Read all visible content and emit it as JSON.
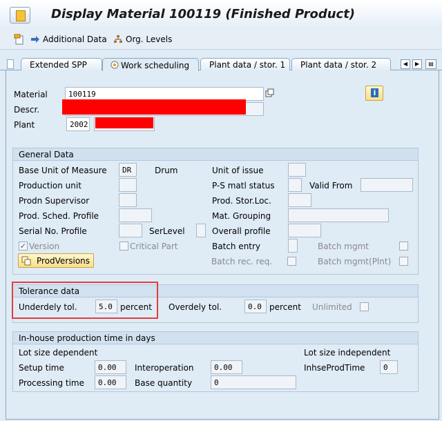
{
  "window": {
    "title": "Display Material 100119 (Finished Product)"
  },
  "toolbar": {
    "additional_data": "Additional Data",
    "org_levels": "Org. Levels"
  },
  "tabs": [
    {
      "label": "Extended SPP"
    },
    {
      "label": "Work scheduling"
    },
    {
      "label": "Plant data / stor. 1"
    },
    {
      "label": "Plant data / stor. 2"
    }
  ],
  "header": {
    "material_label": "Material",
    "material_value": "100119",
    "descr_label": "Descr.",
    "plant_label": "Plant",
    "plant_value": "2002"
  },
  "general": {
    "title": "General Data",
    "base_uom_label": "Base Unit of Measure",
    "base_uom_value": "DR",
    "base_uom_text": "Drum",
    "unit_issue_label": "Unit of issue",
    "prod_unit_label": "Production unit",
    "ps_status_label": "P-S matl status",
    "valid_from_label": "Valid From",
    "prodn_supervisor_label": "Prodn Supervisor",
    "prod_stor_label": "Prod. Stor.Loc.",
    "sched_profile_label": "Prod. Sched. Profile",
    "mat_grouping_label": "Mat. Grouping",
    "serial_profile_label": "Serial No. Profile",
    "serlevel_label": "SerLevel",
    "overall_profile_label": "Overall profile",
    "version_label": "Version",
    "critical_part_label": "Critical Part",
    "batch_entry_label": "Batch entry",
    "batch_mgmt_label": "Batch mgmt",
    "batch_rec_label": "Batch rec. req.",
    "batch_mgmt_plnt_label": "Batch mgmt(Plnt)",
    "prodversions_btn": "ProdVersions"
  },
  "tolerance": {
    "title": "Tolerance data",
    "underdely_label": "Underdely tol.",
    "underdely_value": "5.0",
    "percent1": "percent",
    "overdely_label": "Overdely tol.",
    "overdely_value": "0.0",
    "percent2": "percent",
    "unlimited_label": "Unlimited"
  },
  "inhouse": {
    "title": "In-house production time in days",
    "lot_dep_label": "Lot size dependent",
    "lot_indep_label": "Lot size independent",
    "setup_label": "Setup time",
    "setup_value": "0.00",
    "interop_label": "Interoperation",
    "interop_value": "0.00",
    "inhse_label": "InhseProdTime",
    "inhse_value": "0",
    "processing_label": "Processing time",
    "processing_value": "0.00",
    "base_qty_label": "Base quantity",
    "base_qty_value": "0"
  },
  "colors": {
    "background": "#dfebf5",
    "highlight": "#e23d3d",
    "redaction": "#ff0000"
  }
}
